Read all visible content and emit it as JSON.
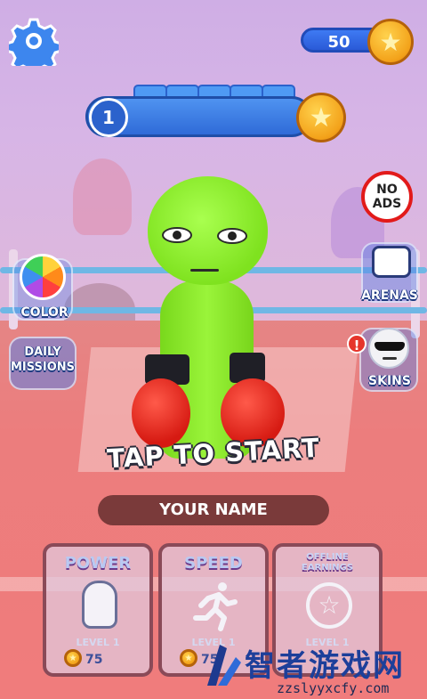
{
  "hud": {
    "coin_balance": "50",
    "level": "1",
    "level_progress_segments": 5
  },
  "side_buttons": {
    "color": "COLOR",
    "daily_missions_line1": "DAILY",
    "daily_missions_line2": "MISSIONS",
    "no_ads_line1": "NO",
    "no_ads_line2": "ADS",
    "arenas": "ARENAS",
    "skins": "SKINS",
    "skins_alert": "!"
  },
  "main": {
    "tap_to_start": "TAP TO START",
    "name_placeholder": "YOUR NAME"
  },
  "upgrades": [
    {
      "title": "POWER",
      "level": "LEVEL 1",
      "cost": "75",
      "icon": "boxing-glove-icon"
    },
    {
      "title": "SPEED",
      "level": "LEVEL 1",
      "cost": "75",
      "icon": "running-man-icon"
    },
    {
      "title": "OFFLINE EARNINGS",
      "level": "LEVEL 1",
      "cost": "",
      "icon": "star-coin-icon"
    }
  ],
  "watermark": {
    "brand": "智者游戏网",
    "url": "zzslyyxcfy.com"
  },
  "colors": {
    "coin": "#f3a21a",
    "hud_blue": "#2f6bd8",
    "character_green": "#8ae83a",
    "glove_red": "#d61a12",
    "floor": "#ec7d7d"
  }
}
